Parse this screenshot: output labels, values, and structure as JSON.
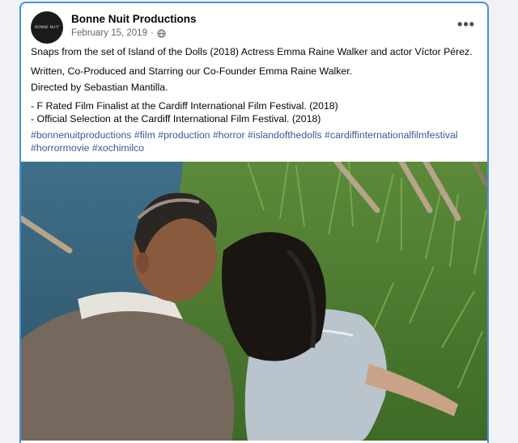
{
  "post": {
    "page_name": "Bonne Nuit Productions",
    "avatar_text": "BONNE NUIT",
    "date": "February 15, 2019",
    "privacy_icon": "globe-icon",
    "more_icon": "more-options-icon",
    "more_label": "•••",
    "paragraphs": [
      "Snaps from the set of Island of the Dolls (2018) Actress Emma Raine Walker and actor Víctor Pérez.",
      "Written, Co-Produced and Starring our Co-Founder Emma Raine Walker.",
      "Directed by Sebastian Mantilla.",
      "- F Rated Film Finalist at the Cardiff International Film Festival. (2018)",
      "- Official Selection at the Cardiff International Film Festival. (2018)"
    ],
    "hashtags": [
      "#bonnenuitproductions",
      "#film",
      "#production",
      "#horror",
      "#islandofthedolls",
      "#cardiffinternationalfilmfestival",
      "#horrormovie",
      "#xochimilco"
    ]
  },
  "colors": {
    "border": "#4a8fe0",
    "link": "#385898",
    "meta_text": "#65676b"
  }
}
